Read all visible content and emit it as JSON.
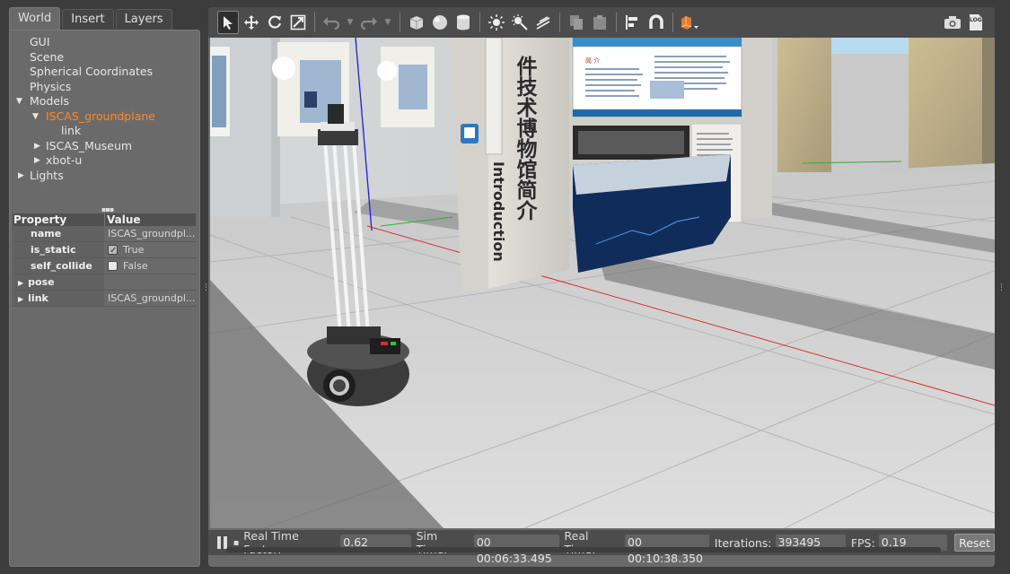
{
  "tabs": [
    "World",
    "Insert",
    "Layers"
  ],
  "tree": [
    {
      "label": "GUI",
      "indent": 0,
      "arrow": ""
    },
    {
      "label": "Scene",
      "indent": 0,
      "arrow": ""
    },
    {
      "label": "Spherical Coordinates",
      "indent": 0,
      "arrow": ""
    },
    {
      "label": "Physics",
      "indent": 0,
      "arrow": ""
    },
    {
      "label": "Models",
      "indent": 0,
      "arrow": "▼"
    },
    {
      "label": "ISCAS_groundplane",
      "indent": 1,
      "arrow": "▼",
      "selected": true
    },
    {
      "label": "link",
      "indent": 2,
      "arrow": ""
    },
    {
      "label": "ISCAS_Museum",
      "indent": 1,
      "arrow": "▶"
    },
    {
      "label": "xbot-u",
      "indent": 1,
      "arrow": "▶"
    },
    {
      "label": "Lights",
      "indent": 0,
      "arrow": "▶"
    }
  ],
  "properties": {
    "header": {
      "property": "Property",
      "value": "Value"
    },
    "name": {
      "label": "name",
      "value": "ISCAS_groundpl..."
    },
    "is_static": {
      "label": "is_static",
      "value": "True",
      "checked": true
    },
    "self_collide": {
      "label": "self_collide",
      "value": "False",
      "checked": false
    },
    "pose": {
      "label": "pose"
    },
    "link": {
      "label": "link",
      "value": "ISCAS_groundpl..."
    }
  },
  "toolbar": {
    "icons": [
      "select-arrow-icon",
      "translate-icon",
      "rotate-icon",
      "scale-icon",
      "undo-icon",
      "redo-icon",
      "box-icon",
      "sphere-icon",
      "cylinder-icon",
      "point-light-icon",
      "spot-light-icon",
      "directional-light-icon",
      "copy-icon",
      "paste-icon",
      "align-icon",
      "snap-icon",
      "view-angle-icon",
      "screenshot-icon",
      "log-icon"
    ],
    "log_label": "LOG"
  },
  "scene": {
    "sign_vertical_cn": "件技术博物馆简介",
    "sign_vertical_en": "Introduction",
    "panel_title": "简 介"
  },
  "status": {
    "rtf_label": "Real Time Factor:",
    "rtf_value": "0.62",
    "sim_label": "Sim Time:",
    "sim_value": "00 00:06:33.495",
    "real_label": "Real Time:",
    "real_value": "00 00:10:38.350",
    "iter_label": "Iterations:",
    "iter_value": "393495",
    "fps_label": "FPS:",
    "fps_value": "0.19",
    "reset_label": "Reset"
  },
  "colors": {
    "selected": "#ff8a2a",
    "panel": "#6a6a6a",
    "toolbar": "#4c4c4c",
    "accent_box": "#f07820"
  }
}
